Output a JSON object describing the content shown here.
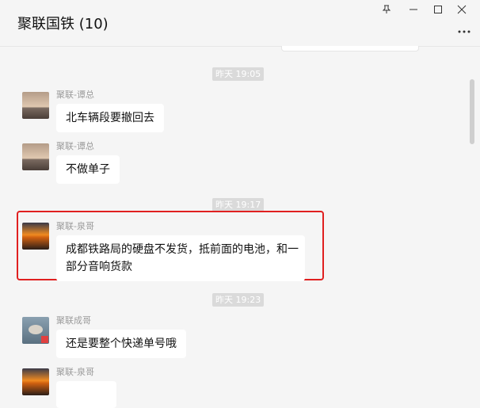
{
  "window": {
    "title": "聚联国铁 (10)",
    "pin_icon": "pin-icon",
    "min_icon": "minimize-icon",
    "max_icon": "maximize-icon",
    "close_icon": "close-icon",
    "more_icon": "more-icon"
  },
  "timestamps": [
    "昨天 19:05",
    "昨天 19:17",
    "昨天 19:23"
  ],
  "messages": [
    {
      "sender": "聚联-谭总",
      "text": "北车辆段要撤回去"
    },
    {
      "sender": "聚联-谭总",
      "text": "不做单子"
    },
    {
      "sender": "聚联-泉哥",
      "text_line1": "成都铁路局的硬盘不发货，抵前面的电池，和一",
      "text_line2": "部分音响货款"
    },
    {
      "sender": "聚联成哥",
      "text": "还是要整个快递单号哦"
    },
    {
      "sender": "聚联-泉哥",
      "text": ""
    }
  ],
  "colors": {
    "highlight": "#e02020",
    "bubble": "#ffffff",
    "background": "#f5f5f5"
  }
}
